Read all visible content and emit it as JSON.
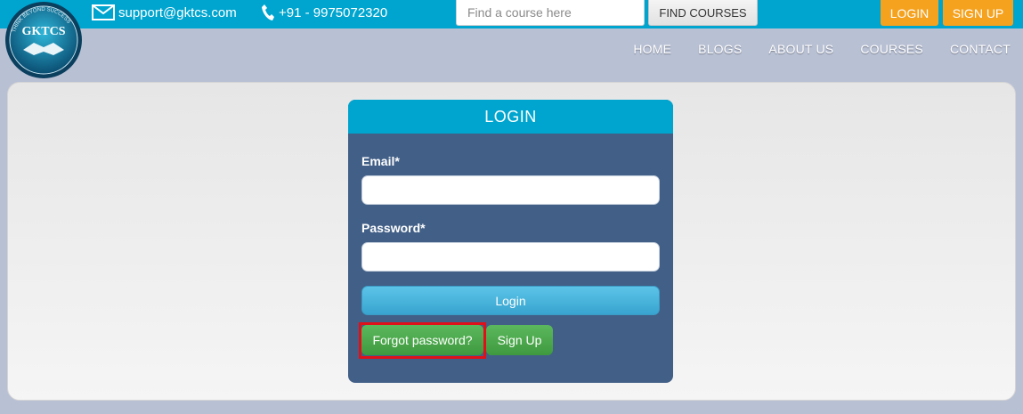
{
  "header": {
    "email": "support@gktcs.com",
    "phone": "+91 - 9975072320",
    "search_placeholder": "Find a course here",
    "find_button": "FIND COURSES",
    "login_button": "LOGIN",
    "signup_button": "SIGN UP"
  },
  "logo": {
    "text": "GKTCS",
    "tagline": "THINK BEYOND SUCCESS"
  },
  "nav": {
    "items": [
      "HOME",
      "BLOGS",
      "ABOUT US",
      "COURSES",
      "CONTACT"
    ]
  },
  "login_form": {
    "title": "LOGIN",
    "email_label": "Email*",
    "email_value": "",
    "password_label": "Password*",
    "password_value": "",
    "submit_label": "Login",
    "forgot_label": "Forgot password?",
    "signup_label": "Sign Up"
  },
  "colors": {
    "topbar": "#00a5cf",
    "orange_button": "#f5a21f",
    "form_bg": "#415f87",
    "green_button": "#4cae4c",
    "highlight": "#e0101a"
  }
}
